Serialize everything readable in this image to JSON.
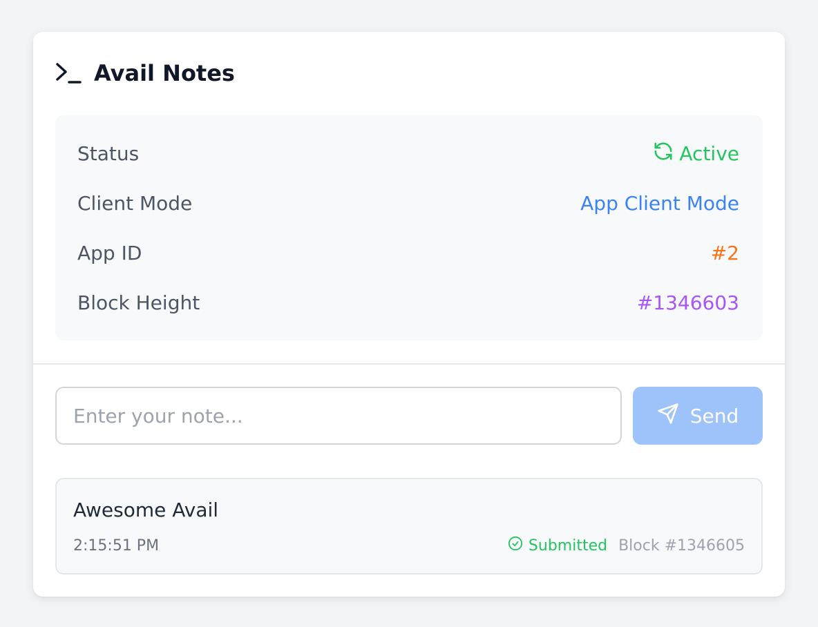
{
  "header": {
    "icon": "terminal-icon",
    "title": "Avail Notes"
  },
  "info": {
    "rows": [
      {
        "label": "Status",
        "value": "Active",
        "icon": "refresh-icon",
        "color": "#22c55e"
      },
      {
        "label": "Client Mode",
        "value": "App Client Mode",
        "color": "#3b82f6"
      },
      {
        "label": "App ID",
        "value": "#2",
        "color": "#f97316"
      },
      {
        "label": "Block Height",
        "value": "#1346603",
        "color": "#a855f7"
      }
    ]
  },
  "compose": {
    "placeholder": "Enter your note...",
    "value": "",
    "send_label": "Send",
    "send_icon": "send-icon"
  },
  "notes": [
    {
      "text": "Awesome Avail",
      "time": "2:15:51 PM",
      "status": "Submitted",
      "status_icon": "check-circle-icon",
      "block": "Block #1346605"
    }
  ],
  "colors": {
    "background": "#f3f4f6",
    "card": "#ffffff",
    "panel": "#f8f9fb",
    "send_button": "#9ec2fa",
    "title": "#111827"
  }
}
